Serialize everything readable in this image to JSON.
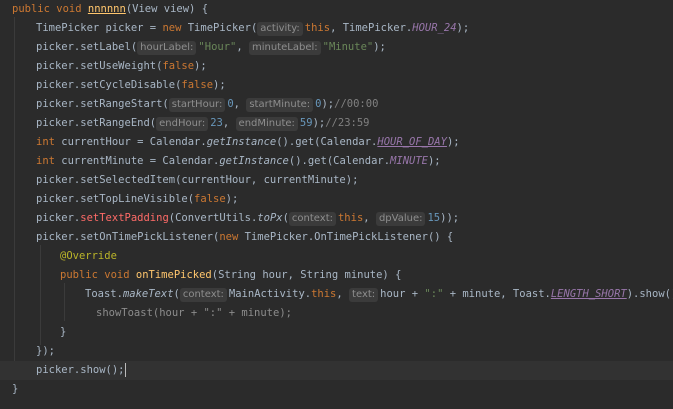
{
  "code": {
    "method_sig": {
      "kw_public": "public",
      "kw_void": "void",
      "name": "nnnnnn",
      "params": "(View view)",
      "brace": " {"
    },
    "l2": {
      "decl": "TimePicker picker = ",
      "kw_new": "new",
      "ctor": " TimePicker(",
      "hint_activity": "activity:",
      "this_kw": "this",
      "comma": ", TimePicker.",
      "const": "HOUR_24",
      "end": ");"
    },
    "l3": {
      "call": "picker.setLabel(",
      "hint_hour": "hourLabel:",
      "hour_str": "\"Hour\"",
      "comma": ", ",
      "hint_minute": "minuteLabel:",
      "minute_str": "\"Minute\"",
      "end": ");"
    },
    "l4": {
      "call": "picker.setUseWeight(",
      "val": "false",
      "end": ");"
    },
    "l5": {
      "call": "picker.setCycleDisable(",
      "val": "false",
      "end": ");"
    },
    "l6": {
      "call": "picker.setRangeStart(",
      "hint_sh": "startHour:",
      "v1": "0",
      "comma": ", ",
      "hint_sm": "startMinute:",
      "v2": "0",
      "end": ");",
      "comment": "//00:00"
    },
    "l7": {
      "call": "picker.setRangeEnd(",
      "hint_eh": "endHour:",
      "v1": "23",
      "comma": ", ",
      "hint_em": "endMinute:",
      "v2": "59",
      "end": ");",
      "comment": "//23:59"
    },
    "l8": {
      "kw_int": "int",
      "decl": " currentHour = Calendar.",
      "method": "getInstance",
      "mid": "().get(Calendar.",
      "const": "HOUR_OF_DAY",
      "end": ");"
    },
    "l9": {
      "kw_int": "int",
      "decl": " currentMinute = Calendar.",
      "method": "getInstance",
      "mid": "().get(Calendar.",
      "const": "MINUTE",
      "end": ");"
    },
    "l10": {
      "text": "picker.setSelectedItem(currentHour, currentMinute);"
    },
    "l11": {
      "call": "picker.setTopLineVisible(",
      "val": "false",
      "end": ");"
    },
    "l12": {
      "pre": "picker.",
      "call": "setTextPadding",
      "mid": "(ConvertUtils.",
      "method": "toPx",
      "open": "(",
      "hint_ctx": "context:",
      "this_kw": "this",
      "comma": ", ",
      "hint_dp": "dpValue:",
      "val": "15",
      "end": "));"
    },
    "l13": {
      "call": "picker.setOnTimePickListener(",
      "kw_new": "new",
      "rest": " TimePicker.OnTimePickListener() {"
    },
    "l14": {
      "ann": "@Override"
    },
    "l15": {
      "kw_public": "public",
      "kw_void": "void",
      "name": "onTimePicked",
      "params": "(String hour, String minute) {"
    },
    "l16": {
      "pre": "Toast.",
      "method": "makeText",
      "open": "(",
      "hint_ctx": "context:",
      "main": "MainActivity.",
      "this_kw": "this",
      "comma": ", ",
      "hint_text": "text:",
      "expr": "hour + ",
      "colon_str": "\":\"",
      "expr2": " + minute, Toast.",
      "const": "LENGTH_SHORT",
      "end": ").show();"
    },
    "l17": {
      "text": "showToast(hour + \":\" + minute);"
    },
    "l18": {
      "text": "}"
    },
    "l19": {
      "text": "});"
    },
    "l20": {
      "text": "picker.show();"
    },
    "l21": {
      "text": "}"
    }
  }
}
